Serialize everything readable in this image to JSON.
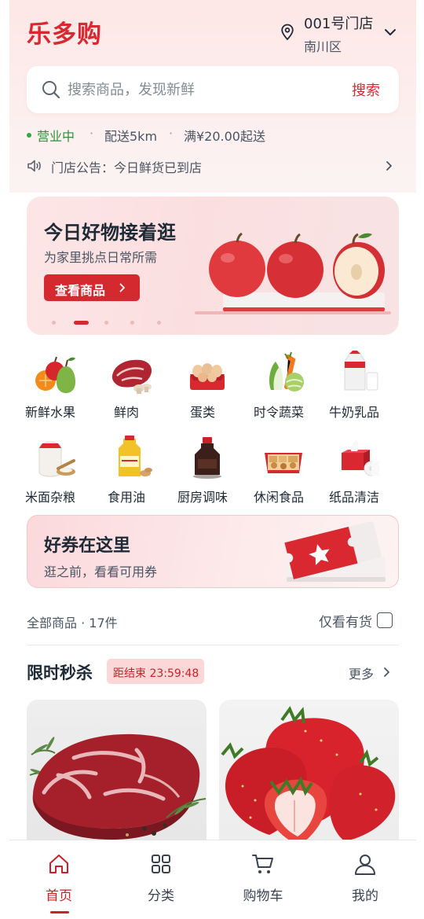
{
  "header": {
    "brand": "乐多购",
    "store_name": "001号门店",
    "store_district": "南川区"
  },
  "search": {
    "placeholder": "搜索商品，发现新鲜",
    "button_label": "搜索"
  },
  "store_status": {
    "open": "营业中",
    "delivery_range": "配送5km",
    "min_order": "满¥20.00起送"
  },
  "notice": {
    "text": "门店公告：今日鲜货已到店"
  },
  "banner": {
    "title": "今日好物接着逛",
    "subtitle": "为家里挑点日常所需",
    "cta_label": "查看商品",
    "slide_count": 5,
    "active_slide": 2
  },
  "categories": [
    {
      "label": "新鲜水果",
      "icon": "fruit-icon"
    },
    {
      "label": "鲜肉",
      "icon": "meat-icon"
    },
    {
      "label": "蛋类",
      "icon": "eggs-icon"
    },
    {
      "label": "时令蔬菜",
      "icon": "vegetables-icon"
    },
    {
      "label": "牛奶乳品",
      "icon": "milk-icon"
    },
    {
      "label": "米面杂粮",
      "icon": "rice-flour-icon"
    },
    {
      "label": "食用油",
      "icon": "cooking-oil-icon"
    },
    {
      "label": "厨房调味",
      "icon": "soy-sauce-icon"
    },
    {
      "label": "休闲食品",
      "icon": "snacks-icon"
    },
    {
      "label": "纸品清洁",
      "icon": "tissue-icon"
    }
  ],
  "coupon": {
    "title": "好券在这里",
    "subtitle": "逛之前，看看可用券"
  },
  "product_filter": {
    "summary": "全部商品 · 17件",
    "in_stock_label": "仅看有货",
    "in_stock_checked": false
  },
  "flash_sale": {
    "title": "限时秒杀",
    "countdown": "距结束 23:59:48",
    "more_label": "更多"
  },
  "flash_products": [
    {
      "image": "steak-photo"
    },
    {
      "image": "strawberry-photo"
    }
  ],
  "tabbar": [
    {
      "label": "首页",
      "icon": "home-icon",
      "active": true
    },
    {
      "label": "分类",
      "icon": "grid-icon",
      "active": false
    },
    {
      "label": "购物车",
      "icon": "cart-icon",
      "active": false
    },
    {
      "label": "我的",
      "icon": "user-icon",
      "active": false
    }
  ],
  "colors": {
    "brand": "#d9282f",
    "accent": "#c8232a",
    "open_status": "#2f8f3a"
  }
}
